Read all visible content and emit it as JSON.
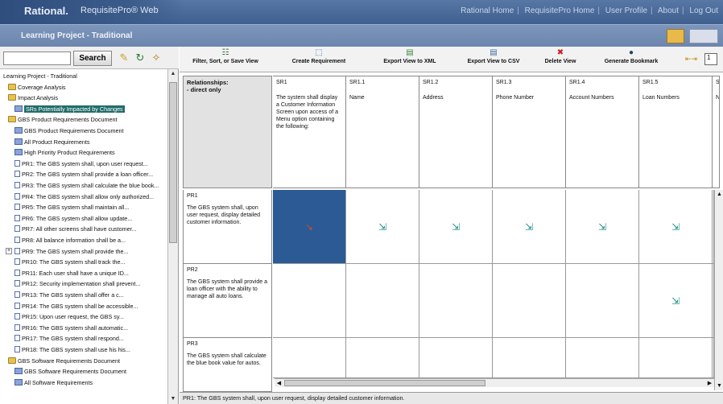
{
  "header": {
    "brand": "Rational.",
    "product": "RequisitePro® Web",
    "links": [
      "Rational Home",
      "RequisitePro Home",
      "User Profile",
      "About",
      "Log Out"
    ]
  },
  "project": {
    "title": "Learning Project - Traditional"
  },
  "search": {
    "placeholder": "",
    "button_label": "Search"
  },
  "tree": {
    "items": [
      {
        "label": "Learning Project - Traditional",
        "icon": "none",
        "indent": 0
      },
      {
        "label": "Coverage Analysis",
        "icon": "folder",
        "indent": 1
      },
      {
        "label": "Impact Analysis",
        "icon": "folder",
        "indent": 1
      },
      {
        "label": "SRs Potentially Impacted by Changes",
        "icon": "view",
        "indent": 2,
        "selected": true
      },
      {
        "label": "GBS Product Requirements Document",
        "icon": "folder",
        "indent": 1
      },
      {
        "label": "GBS Product Requirements Document",
        "icon": "view",
        "indent": 2
      },
      {
        "label": "All Product Requirements",
        "icon": "view",
        "indent": 2
      },
      {
        "label": "High Priority Product Requirements",
        "icon": "view",
        "indent": 2
      },
      {
        "label": "PR1: The GBS system shall, upon user request...",
        "icon": "req",
        "indent": 2
      },
      {
        "label": "PR2: The GBS system shall provide a loan officer...",
        "icon": "req",
        "indent": 2
      },
      {
        "label": "PR3: The GBS system shall calculate the blue book...",
        "icon": "req",
        "indent": 2
      },
      {
        "label": "PR4: The GBS system shall allow only authorized...",
        "icon": "req",
        "indent": 2
      },
      {
        "label": "PR5: The GBS system shall maintain all...",
        "icon": "req",
        "indent": 2
      },
      {
        "label": "PR6: The GBS system shall allow update...",
        "icon": "req",
        "indent": 2
      },
      {
        "label": "PR7: All other screens shall have customer...",
        "icon": "req",
        "indent": 2
      },
      {
        "label": "PR8: All balance information shall be a...",
        "icon": "req",
        "indent": 2
      },
      {
        "label": "PR9: The GBS system shall provide the...",
        "icon": "req",
        "indent": 2,
        "expander": true
      },
      {
        "label": "PR10: The GBS system shall track the...",
        "icon": "req",
        "indent": 2
      },
      {
        "label": "PR11: Each user shall have a unique ID...",
        "icon": "req",
        "indent": 2
      },
      {
        "label": "PR12: Security implementation shall prevent...",
        "icon": "req",
        "indent": 2
      },
      {
        "label": "PR13: The GBS system shall offer a c...",
        "icon": "req",
        "indent": 2
      },
      {
        "label": "PR14: The GBS system shall be accessible...",
        "icon": "req",
        "indent": 2
      },
      {
        "label": "PR15: Upon user request, the GBS sy...",
        "icon": "req",
        "indent": 2
      },
      {
        "label": "PR16: The GBS system shall automatic...",
        "icon": "req",
        "indent": 2
      },
      {
        "label": "PR17: The GBS system shall respond...",
        "icon": "req",
        "indent": 2
      },
      {
        "label": "PR18: The GBS system shall use his his...",
        "icon": "req",
        "indent": 2
      },
      {
        "label": "GBS Software Requirements Document",
        "icon": "folder",
        "indent": 1
      },
      {
        "label": "GBS Software Requirements Document",
        "icon": "view",
        "indent": 2
      },
      {
        "label": "All Software Requirements",
        "icon": "view",
        "indent": 2
      }
    ]
  },
  "toolbar": {
    "buttons": [
      {
        "label": "Filter, Sort, or Save View",
        "icon": "filter-icon",
        "glyph": "☷",
        "color": "#3b6a3b"
      },
      {
        "label": "Create Requirement",
        "icon": "create-requirement-icon",
        "glyph": "⬚",
        "color": "#2d5fa8"
      },
      {
        "label": "Export View to XML",
        "icon": "export-xml-icon",
        "glyph": "▤",
        "color": "#3c8a3c"
      },
      {
        "label": "Export View to CSV",
        "icon": "export-csv-icon",
        "glyph": "▤",
        "color": "#3c6a9a"
      },
      {
        "label": "Delete View",
        "icon": "delete-icon",
        "glyph": "✖",
        "color": "#cc1a1a"
      },
      {
        "label": "Generate Bookmark",
        "icon": "bookmark-icon",
        "glyph": "●",
        "color": "#1a4a6a"
      }
    ],
    "page_value": "1"
  },
  "grid": {
    "corner": "Relationships:\n - direct only",
    "columns": [
      {
        "id": "SR1",
        "text": "The system shall display a Customer Information Screen upon access of a Menu option containing the following:"
      },
      {
        "id": "SR1.1",
        "text": "Name"
      },
      {
        "id": "SR1.2",
        "text": "Address"
      },
      {
        "id": "SR1.3",
        "text": "Phone Number"
      },
      {
        "id": "SR1.4",
        "text": "Account Numbers"
      },
      {
        "id": "SR1.5",
        "text": "Loan Numbers"
      },
      {
        "id": "S",
        "text": "N"
      }
    ],
    "rows": [
      {
        "id": "PR1",
        "text": "The GBS system shall, upon user request, display detailed customer information."
      },
      {
        "id": "PR2",
        "text": "The GBS system shall provide a loan officer with the ability to manage all auto loans."
      },
      {
        "id": "PR3",
        "text": "The GBS system shall calculate the blue book value for autos."
      }
    ],
    "links": [
      [
        true,
        true,
        true,
        true,
        true,
        true,
        false
      ],
      [
        false,
        false,
        false,
        false,
        false,
        true,
        false
      ],
      [
        false,
        false,
        false,
        false,
        false,
        false,
        false
      ]
    ],
    "selected_cell": [
      0,
      0
    ]
  },
  "status": {
    "text": "PR1: The GBS system shall, upon user request, display detailed customer information."
  }
}
